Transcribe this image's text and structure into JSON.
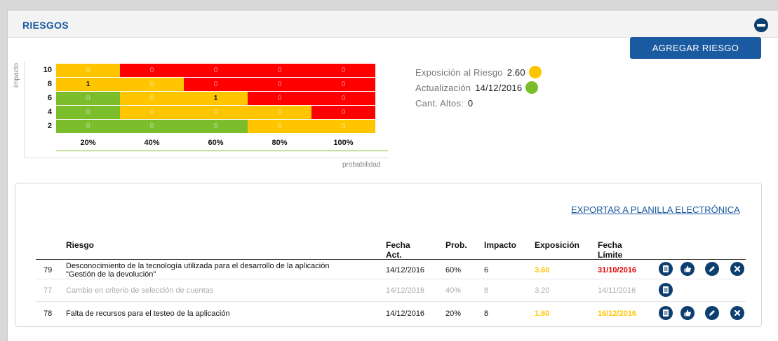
{
  "panel": {
    "title": "RIESGOS",
    "add_button": "AGREGAR RIESGO",
    "collapse_icon": "minus-circle-icon"
  },
  "matrix": {
    "y_axis_label": "impacto",
    "x_axis_label": "probabilidad",
    "rows": [
      {
        "impact": "10",
        "cells": [
          {
            "value": "0",
            "color": "yellow"
          },
          {
            "value": "0",
            "color": "red"
          },
          {
            "value": "0",
            "color": "red"
          },
          {
            "value": "0",
            "color": "red"
          },
          {
            "value": "0",
            "color": "red"
          }
        ]
      },
      {
        "impact": "8",
        "cells": [
          {
            "value": "1",
            "color": "yellow"
          },
          {
            "value": "0",
            "color": "yellow"
          },
          {
            "value": "0",
            "color": "red"
          },
          {
            "value": "0",
            "color": "red"
          },
          {
            "value": "0",
            "color": "red"
          }
        ]
      },
      {
        "impact": "6",
        "cells": [
          {
            "value": "0",
            "color": "green"
          },
          {
            "value": "0",
            "color": "yellow"
          },
          {
            "value": "1",
            "color": "yellow"
          },
          {
            "value": "0",
            "color": "red"
          },
          {
            "value": "0",
            "color": "red"
          }
        ]
      },
      {
        "impact": "4",
        "cells": [
          {
            "value": "0",
            "color": "green"
          },
          {
            "value": "0",
            "color": "yellow"
          },
          {
            "value": "0",
            "color": "yellow"
          },
          {
            "value": "0",
            "color": "yellow"
          },
          {
            "value": "0",
            "color": "red"
          }
        ]
      },
      {
        "impact": "2",
        "cells": [
          {
            "value": "0",
            "color": "green"
          },
          {
            "value": "0",
            "color": "green"
          },
          {
            "value": "0",
            "color": "green"
          },
          {
            "value": "0",
            "color": "yellow"
          },
          {
            "value": "0",
            "color": "yellow"
          }
        ]
      }
    ],
    "probabilities": [
      "20%",
      "40%",
      "60%",
      "80%",
      "100%"
    ],
    "colors": {
      "yellow": "#ffc600",
      "red": "#ff0000",
      "green": "#7cbd2c"
    }
  },
  "stats": {
    "exposicion_label": "Exposición al Riesgo",
    "exposicion_value": "2.60",
    "exposicion_color": "#ffc600",
    "actualizacion_label": "Actualización",
    "actualizacion_value": "14/12/2016",
    "actualizacion_color": "#7cbd2c",
    "altos_label": "Cant. Altos:",
    "altos_value": "0"
  },
  "table": {
    "export_link": "EXPORTAR A PLANILLA ELECTRÓNICA",
    "headers": {
      "riesgo": "Riesgo",
      "fecha_act_1": "Fecha",
      "fecha_act_2": "Act.",
      "prob": "Prob.",
      "impacto": "Impacto",
      "exposicion": "Exposición",
      "fecha_lim_1": "Fecha",
      "fecha_lim_2": "Límite"
    },
    "rows": [
      {
        "id": "79",
        "riesgo": "Desconocimiento de la tecnología utilizada para el desarrollo de la aplicación \"Gestión de la devolución\"",
        "fecha_act": "14/12/2016",
        "prob": "60%",
        "impacto": "6",
        "exposicion": "3.60",
        "fecha_limite": "31/10/2016",
        "muted": false,
        "actions": [
          "document-icon",
          "thumbs-up-icon",
          "pencil-icon",
          "close-icon"
        ]
      },
      {
        "id": "77",
        "riesgo": "Cambio en criterio de selección de cuentas",
        "fecha_act": "14/12/2016",
        "prob": "40%",
        "impacto": "8",
        "exposicion": "3.20",
        "fecha_limite": "14/11/2016",
        "muted": true,
        "actions": [
          "document-icon"
        ]
      },
      {
        "id": "78",
        "riesgo": "Falta de recursos para el testeo de la aplicación",
        "fecha_act": "14/12/2016",
        "prob": "20%",
        "impacto": "8",
        "exposicion": "1.60",
        "fecha_limite": "16/12/2016",
        "muted": false,
        "actions": [
          "document-icon",
          "thumbs-up-icon",
          "pencil-icon",
          "close-icon"
        ]
      }
    ]
  }
}
